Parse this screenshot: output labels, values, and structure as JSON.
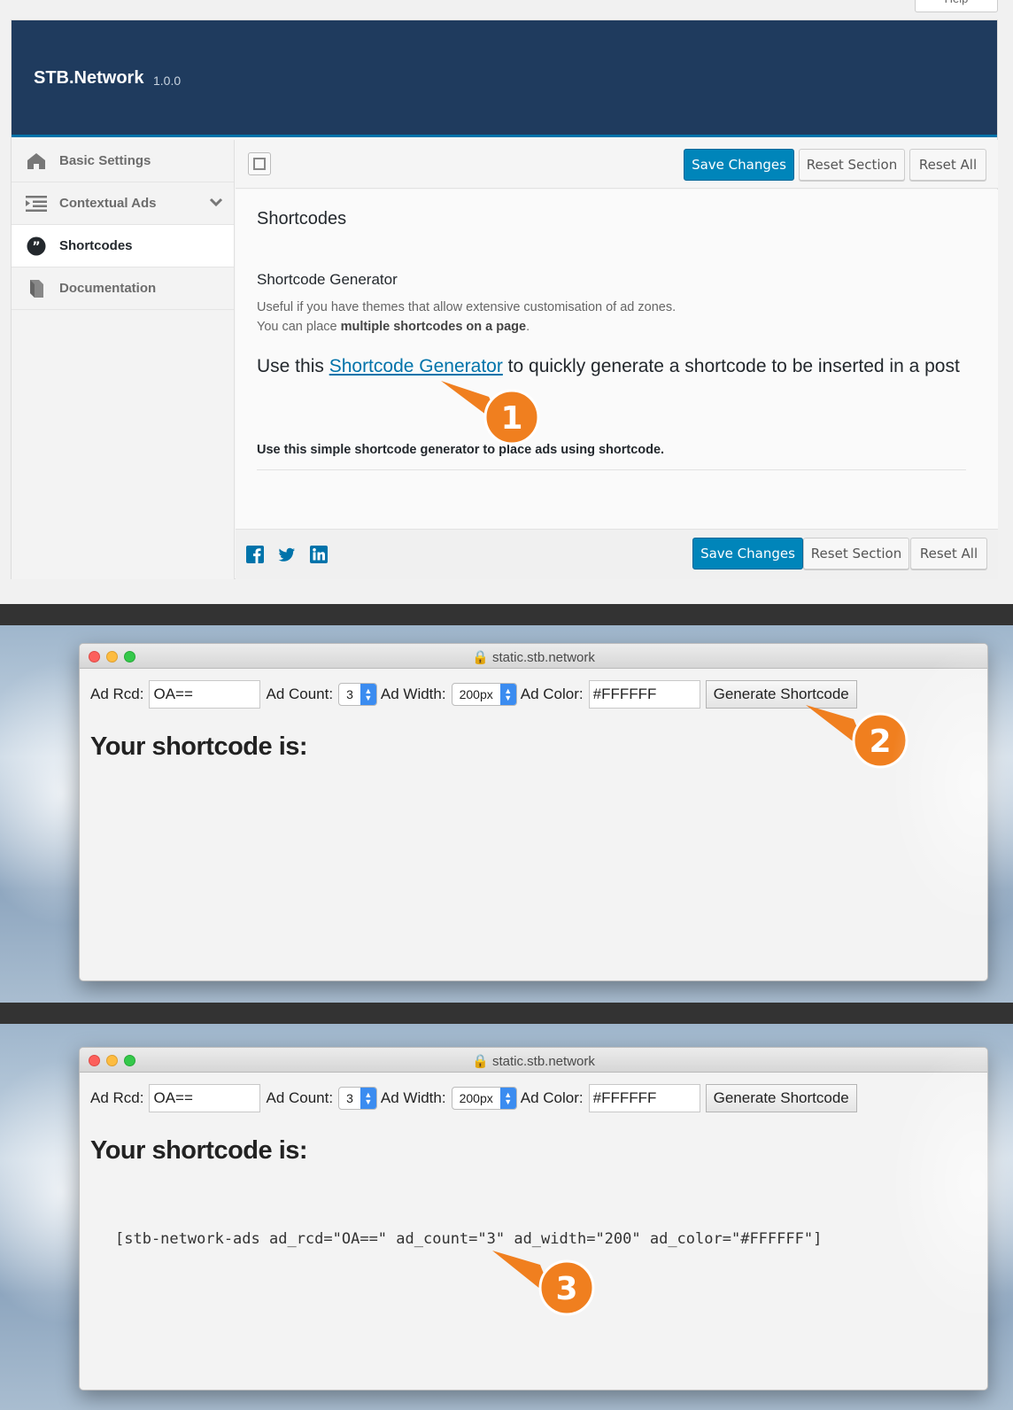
{
  "admin": {
    "help_label": "Help",
    "brand": "STB.Network",
    "version": "1.0.0",
    "sidebar": {
      "items": [
        {
          "label": "Basic Settings",
          "icon": "home-icon",
          "active": false
        },
        {
          "label": "Contextual Ads",
          "icon": "list-indent-icon",
          "active": false,
          "has_submenu": true
        },
        {
          "label": "Shortcodes",
          "icon": "quote-icon",
          "active": true
        },
        {
          "label": "Documentation",
          "icon": "book-icon",
          "active": false
        }
      ]
    },
    "toolbar": {
      "save_label": "Save Changes",
      "reset_section_label": "Reset Section",
      "reset_all_label": "Reset All"
    },
    "main": {
      "section_title": "Shortcodes",
      "generator_title": "Shortcode Generator",
      "desc_line1": "Useful if you have themes that allow extensive customisation of ad zones.",
      "desc_line2_pre": "You can place ",
      "desc_line2_bold": "multiple shortcodes on a page",
      "desc_line2_post": ".",
      "use_pre": "Use this ",
      "use_link": "Shortcode Generator",
      "use_post": " to quickly generate a shortcode to be inserted in a post",
      "use_simple": "Use this simple shortcode generator to place ads using shortcode."
    },
    "footer": {
      "social": [
        "facebook-icon",
        "twitter-icon",
        "linkedin-icon"
      ]
    }
  },
  "browser": {
    "url": "static.stb.network",
    "ad_rcd_label": "Ad Rcd:",
    "ad_rcd_value": "OA==",
    "ad_count_label": "Ad Count:",
    "ad_count_value": "3",
    "ad_width_label": "Ad Width:",
    "ad_width_value": "200px",
    "ad_color_label": "Ad Color:",
    "ad_color_value": "#FFFFFF",
    "generate_label": "Generate Shortcode",
    "result_title": "Your shortcode is:",
    "shortcode": "[stb-network-ads ad_rcd=\"OA==\" ad_count=\"3\" ad_width=\"200\" ad_color=\"#FFFFFF\"]"
  },
  "callouts": [
    "1",
    "2",
    "3"
  ],
  "colors": {
    "banner": "#1f3b5e",
    "primary": "#0085ba",
    "link": "#0073aa",
    "callout": "#f07f1f"
  }
}
